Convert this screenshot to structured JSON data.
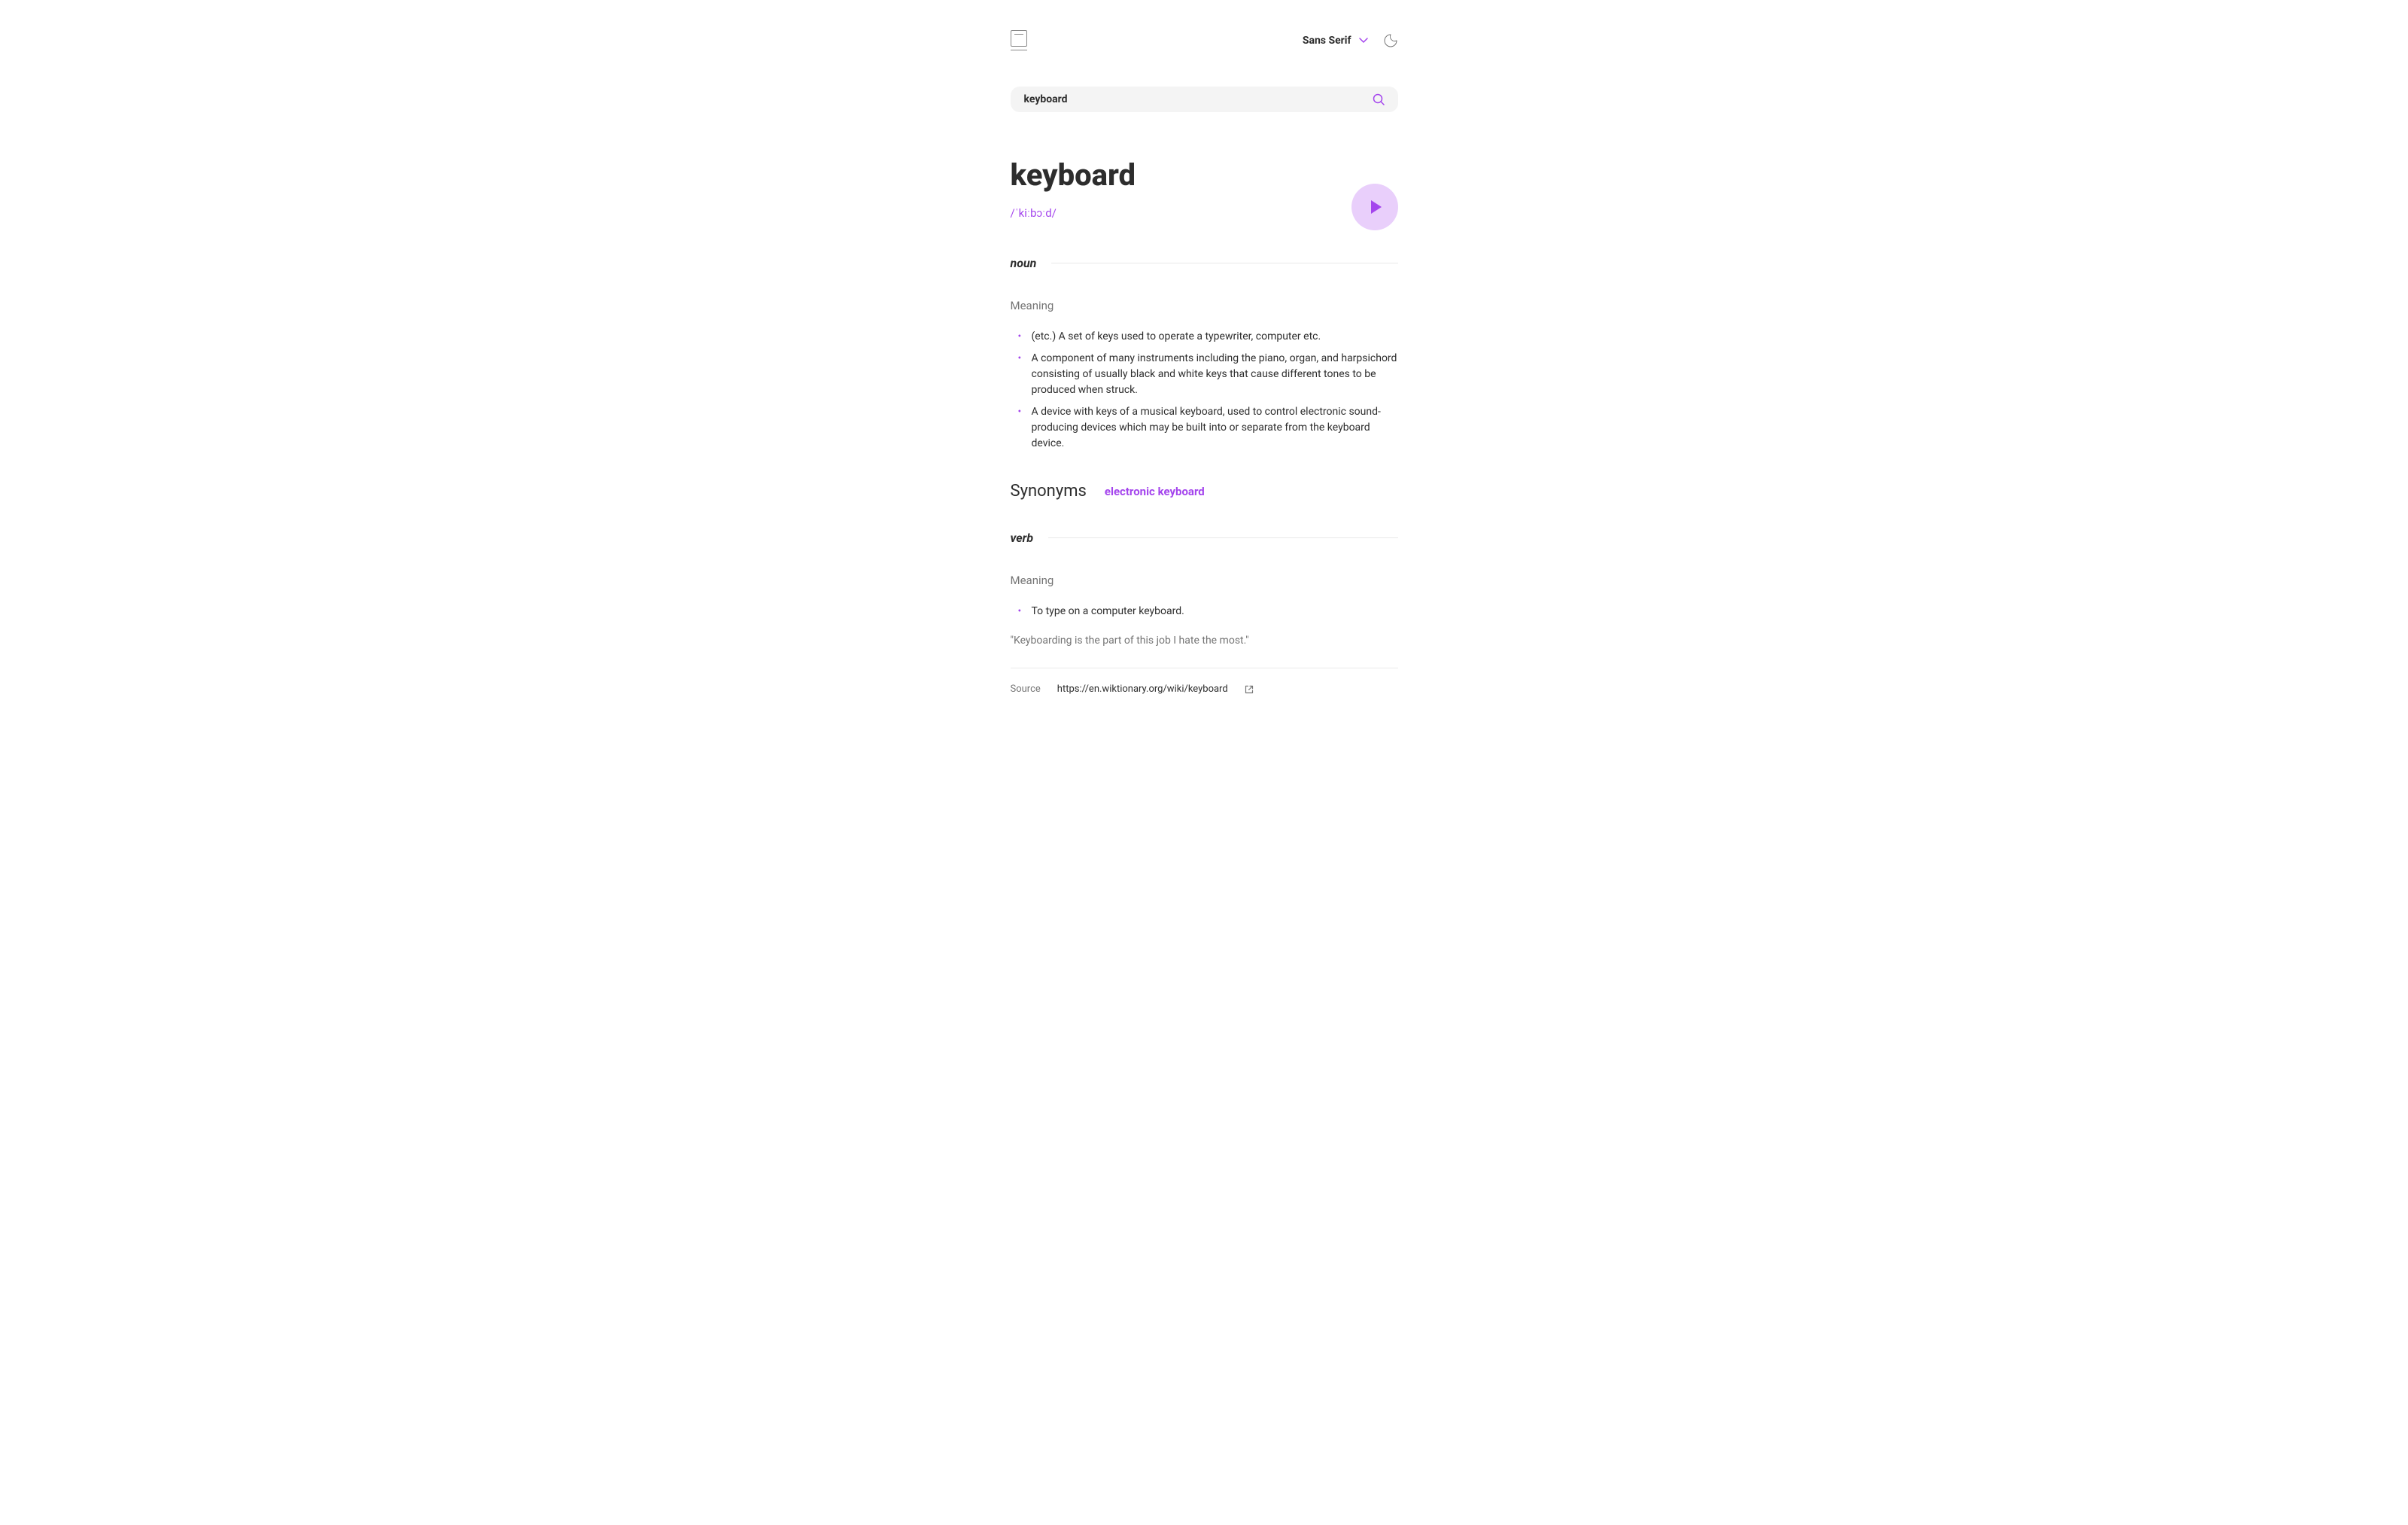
{
  "topbar": {
    "font_selector_label": "Sans Serif"
  },
  "search": {
    "value": "keyboard"
  },
  "word": {
    "title": "keyboard",
    "pronunciation": "/ˈkiːbɔːd/"
  },
  "parts": [
    {
      "pos": "noun",
      "meaning_label": "Meaning",
      "meanings": [
        "(etc.) A set of keys used to operate a typewriter, computer etc.",
        "A component of many instruments including the piano, organ, and harpsichord consisting of usually black and white keys that cause different tones to be produced when struck.",
        "A device with keys of a musical keyboard, used to control electronic sound-producing devices which may be built into or separate from the keyboard device."
      ],
      "synonyms_label": "Synonyms",
      "synonyms": [
        "electronic keyboard"
      ]
    },
    {
      "pos": "verb",
      "meaning_label": "Meaning",
      "meanings": [
        "To type on a computer keyboard."
      ],
      "example": "\"Keyboarding is the part of this job I hate the most.\""
    }
  ],
  "source": {
    "label": "Source",
    "url": "https://en.wiktionary.org/wiki/keyboard"
  }
}
